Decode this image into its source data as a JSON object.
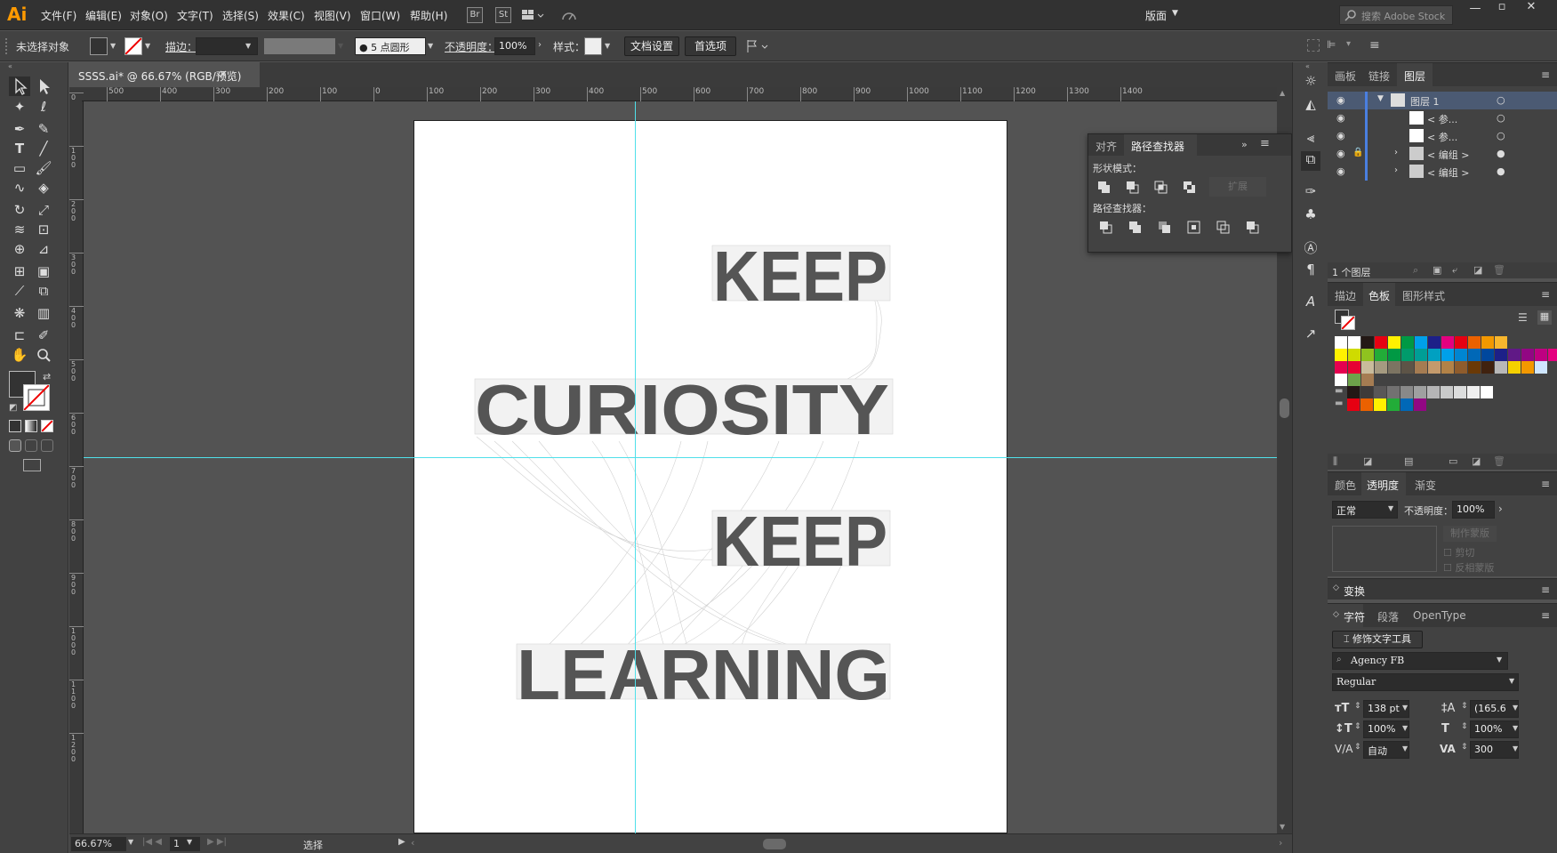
{
  "app": {
    "logo": "Ai"
  },
  "menu": [
    "文件(F)",
    "编辑(E)",
    "对象(O)",
    "文字(T)",
    "选择(S)",
    "效果(C)",
    "视图(V)",
    "窗口(W)",
    "帮助(H)"
  ],
  "bridge_buttons": [
    "Br",
    "St"
  ],
  "workspace": "版面",
  "search": {
    "placeholder": "搜索 Adobe Stock"
  },
  "control": {
    "selection_label": "未选择对象",
    "stroke_label": "描边：",
    "brush_dot": "5",
    "brush_label": "点圆形",
    "opacity_label": "不透明度：",
    "opacity_value": "100%",
    "style_label": "样式：",
    "doc_setup": "文档设置",
    "preferences": "首选项"
  },
  "document": {
    "tab_title": "SSSS.ai* @ 66.67% (RGB/预览)",
    "close": "×",
    "ruler_h_labels": [
      "500",
      "400",
      "300",
      "200",
      "100",
      "0",
      "100",
      "200",
      "300",
      "400",
      "500",
      "600",
      "700",
      "800",
      "900",
      "1000",
      "1100",
      "1200",
      "1300",
      "1400"
    ],
    "ruler_v_labels": [
      "0",
      "100",
      "200",
      "300",
      "400",
      "500",
      "600",
      "700",
      "800",
      "900",
      "1000",
      "1100",
      "1200"
    ],
    "artwork_lines": [
      "KEEP",
      "CURIOSITY",
      "KEEP",
      "LEARNING"
    ]
  },
  "status": {
    "zoom": "66.67%",
    "page": "1",
    "mode": "选择"
  },
  "pathfinder": {
    "tabs": [
      "对齐",
      "路径查找器"
    ],
    "shape_modes_label": "形状模式：",
    "expand": "扩展",
    "pathfinders_label": "路径查找器："
  },
  "layers": {
    "tabs": [
      "画板",
      "链接",
      "图层"
    ],
    "rows": [
      {
        "name": "图层 1",
        "expanded": true
      },
      {
        "name": "< 参..."
      },
      {
        "name": "< 参..."
      },
      {
        "name": "< 编组 >",
        "locked": true
      },
      {
        "name": "< 编组 >"
      }
    ],
    "count": "1 个图层"
  },
  "swatches": {
    "tabs": [
      "描边",
      "色板",
      "图形样式"
    ],
    "rows": [
      [
        "#ffffff",
        "#ffffff",
        "#231815",
        "#e60012",
        "#fff100",
        "#009944",
        "#00a0e9",
        "#1d2088",
        "#e4007f",
        "#e60012",
        "#eb6100",
        "#f39800",
        "#f8b62d"
      ],
      [
        "#fff100",
        "#cfdb00",
        "#8fc31f",
        "#22ac38",
        "#009944",
        "#009b6b",
        "#009e96",
        "#00a0c1",
        "#00a0e9",
        "#0086d1",
        "#0068b7",
        "#00479d",
        "#1d2088",
        "#601986",
        "#920783",
        "#be0081",
        "#e4007f"
      ],
      [
        "#e5004f",
        "#e60033",
        "#c9bc9c",
        "#a59a80",
        "#7c7462",
        "#5d5447",
        "#a57c52",
        "#c49a6c",
        "#b28247",
        "#8f5c2c",
        "#6a3906",
        "#40220f",
        "#b8b8b8",
        "#f5d000",
        "#f39800",
        "#cfe6ff"
      ],
      [
        "#ffffff",
        "#6ea34a",
        "#a57c52"
      ],
      [
        "#231815",
        "#3e3a39",
        "#595757",
        "#727171",
        "#898989",
        "#9fa0a0",
        "#b5b5b6",
        "#c9caca",
        "#dcdddd",
        "#efefef",
        "#ffffff"
      ],
      [
        "#e60012",
        "#eb6100",
        "#fff100",
        "#22ac38",
        "#0068b7",
        "#920783"
      ]
    ]
  },
  "transparency": {
    "tabs": [
      "颜色",
      "透明度",
      "渐变"
    ],
    "blend": "正常",
    "opacity_label": "不透明度：",
    "opacity_value": "100%",
    "make_mask": "制作蒙版",
    "clip": "剪切",
    "invert": "反相蒙版"
  },
  "transform": {
    "title": "变换"
  },
  "character": {
    "tabs": [
      "字符",
      "段落",
      "OpenType"
    ],
    "touch_type": "修饰文字工具",
    "font": "Agency FB",
    "style": "Regular",
    "size": "138 pt",
    "leading": "(165.6",
    "vscale": "100%",
    "hscale": "100%",
    "kerning": "自动",
    "tracking": "300"
  }
}
